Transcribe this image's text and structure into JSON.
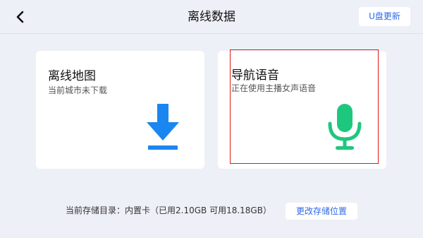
{
  "header": {
    "title": "离线数据",
    "back_icon": "chevron-left-icon",
    "udisk_update_label": "U盘更新"
  },
  "cards": {
    "offline_map": {
      "title": "离线地图",
      "subtitle": "当前城市未下载",
      "icon": "download-icon",
      "icon_color": "#1a86f0"
    },
    "nav_voice": {
      "title": "导航语音",
      "subtitle": "正在使用主播女声语音",
      "icon": "microphone-icon",
      "icon_color": "#1ec77e"
    }
  },
  "footer": {
    "storage_info": "当前存储目录：内置卡（已用2.10GB 可用18.18GB）",
    "change_storage_label": "更改存储位置"
  },
  "colors": {
    "background": "#eef0f7",
    "accent": "#2e6ae6",
    "selection": "#e01b1b"
  }
}
